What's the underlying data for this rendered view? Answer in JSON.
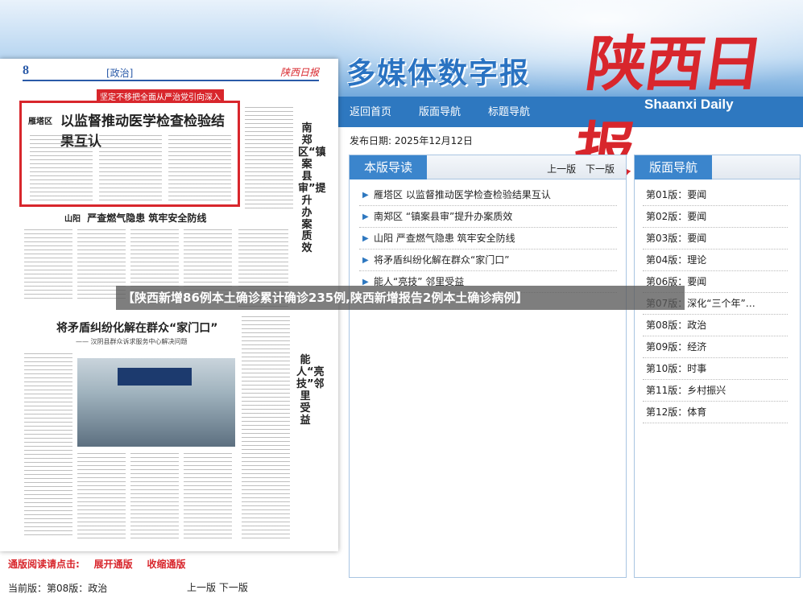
{
  "header": {
    "title": "多媒体数字报",
    "logo_cn": "陕西日报",
    "logo_en": "Shaanxi Daily",
    "nav": [
      "返回首页",
      "版面导航",
      "标题导航"
    ]
  },
  "date_line": "发布日期:  2025年12月12日",
  "paper_page": {
    "number": "8",
    "section": "[政治]",
    "logo": "陕西日报",
    "red_banner": "坚定不移把全面从严治党引向深入",
    "lead_district": "雁塔区",
    "lead_headline": "以监督推动医学检查检验结果互认",
    "sub_loc": "山阳",
    "sub_headline": "严查燃气隐患  筑牢安全防线",
    "vert_headline_1": "南郑区“镇案县审”提升办案质效",
    "headline_2": "将矛盾纠纷化解在群众“家门口”",
    "headline_2_sub": "—— 汉阴县群众诉求服务中心解决问题",
    "vert_headline_2": "能人“亮技”邻里受益"
  },
  "left_links": {
    "label": "通版阅读请点击:",
    "expand": "展开通版",
    "collapse": "收缩通版",
    "current_page": "当前版：第08版：政治",
    "prev": "上一版",
    "next": "下一版"
  },
  "article_panel": {
    "title": "本版导读",
    "prev": "上一版",
    "next": "下一版",
    "items": [
      "雁塔区 以监督推动医学检查检验结果互认",
      "南郑区 “镇案县审”提升办案质效",
      "山阳 严查燃气隐患 筑牢安全防线",
      "将矛盾纠纷化解在群众“家门口”",
      "能人“亮技” 邻里受益"
    ]
  },
  "page_panel": {
    "title": "版面导航",
    "items": [
      "第01版：要闻",
      "第02版：要闻",
      "第03版：要闻",
      "第04版：理论",
      "第06版：要闻",
      "第07版：深化“三个年”…",
      "第08版：政治",
      "第09版：经济",
      "第10版：时事",
      "第11版：乡村振兴",
      "第12版：体育"
    ]
  },
  "overlay_banner": "【陕西新增86例本土确诊累计确诊235例,陕西新增报告2例本土确诊病例】",
  "colors": {
    "brand_red": "#d8262c",
    "brand_blue": "#2e78c0",
    "tab_blue": "#3b85cc"
  }
}
